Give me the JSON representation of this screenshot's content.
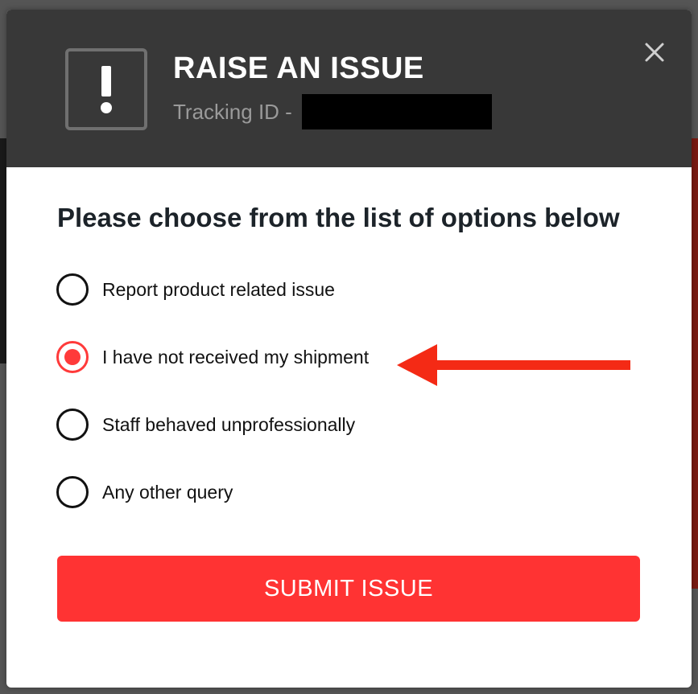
{
  "header": {
    "title": "RAISE AN ISSUE",
    "tracking_label": "Tracking ID -",
    "alert_icon": "exclamation-icon",
    "close_icon": "close-icon"
  },
  "body": {
    "question": "Please choose from the list of options below",
    "options": [
      {
        "label": "Report product related issue",
        "selected": false
      },
      {
        "label": "I have not received my shipment",
        "selected": true
      },
      {
        "label": "Staff behaved unprofessionally",
        "selected": false
      },
      {
        "label": "Any other query",
        "selected": false
      }
    ],
    "submit_label": "SUBMIT ISSUE"
  },
  "colors": {
    "header_bg": "#383838",
    "accent": "#ff3333",
    "arrow": "#f42a15"
  }
}
